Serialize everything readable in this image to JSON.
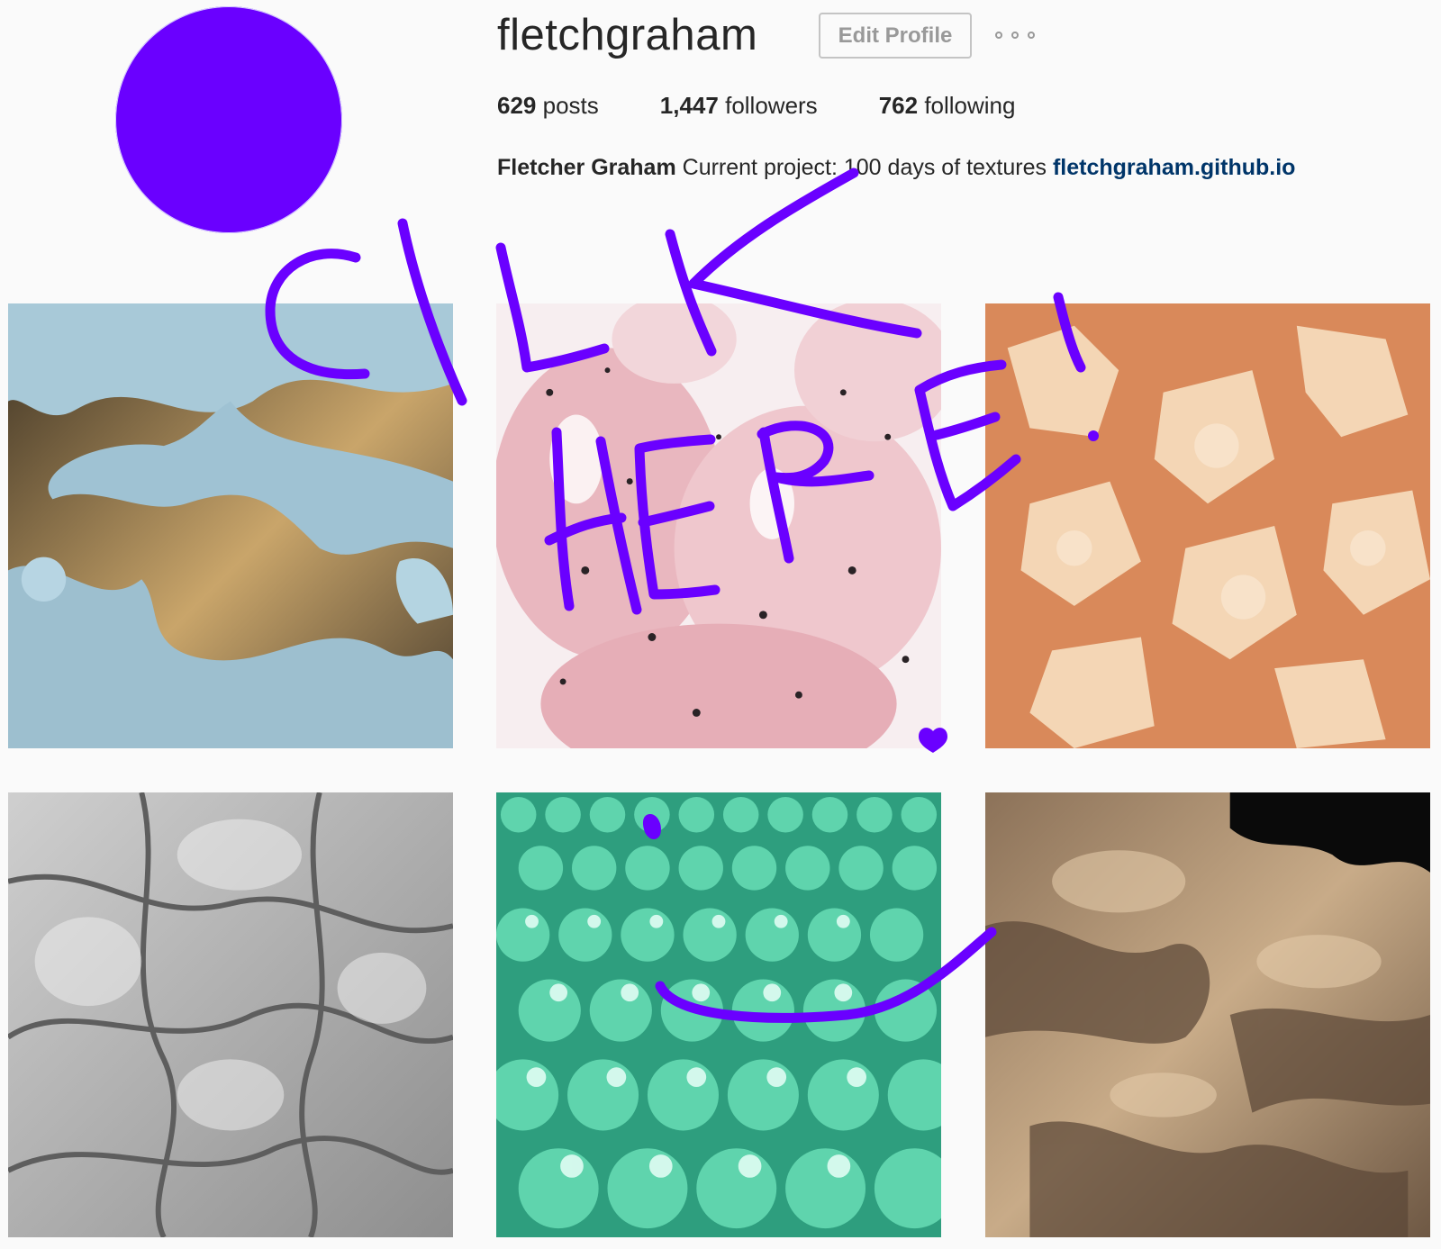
{
  "profile": {
    "username": "fletchgraham",
    "edit_button_label": "Edit Profile",
    "more_icon": "more-options-icon",
    "avatar_color": "#6a00ff"
  },
  "stats": {
    "posts_count": "629",
    "posts_label": "posts",
    "followers_count": "1,447",
    "followers_label": "followers",
    "following_count": "762",
    "following_label": "following"
  },
  "bio": {
    "full_name": "Fletcher Graham",
    "text": "Current project: 100 days of textures",
    "link": "fletchgraham.github.io"
  },
  "annotation": {
    "text": "CILK HERE!",
    "color": "#6a00ff"
  },
  "posts": [
    {
      "texture": "blue metallic marbled"
    },
    {
      "texture": "pink speckled glossy blobs"
    },
    {
      "texture": "peach organic puzzle shapes"
    },
    {
      "texture": "grey wrinkled relief"
    },
    {
      "texture": "mint green glossy spheres"
    },
    {
      "texture": "tan rocky terrain"
    }
  ]
}
